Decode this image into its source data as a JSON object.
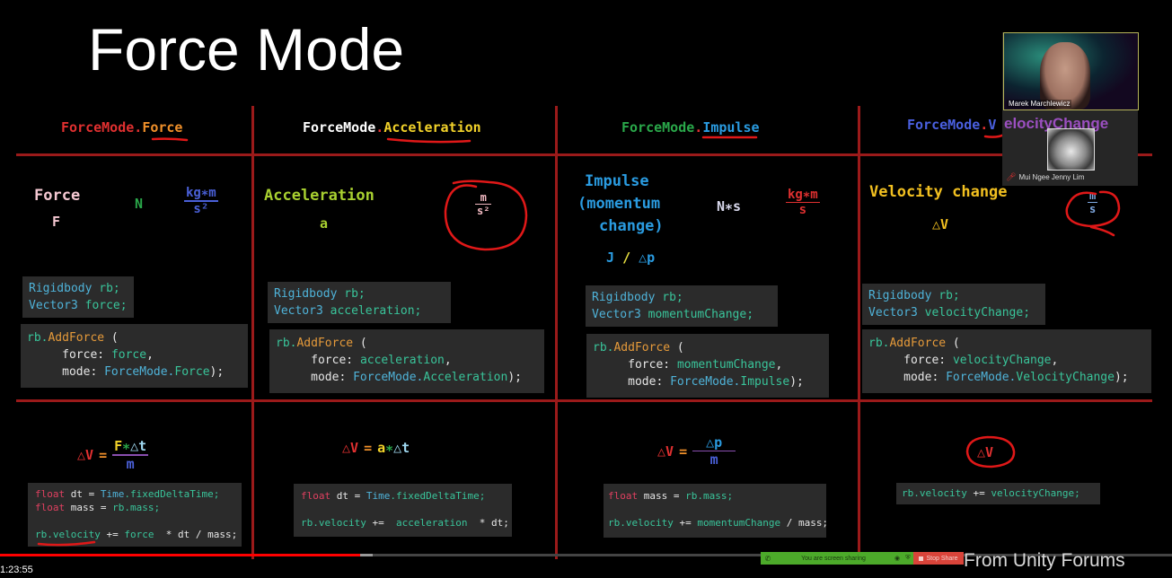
{
  "slide": {
    "title": "Force Mode",
    "columns": [
      {
        "header_prefix": "ForceMode",
        "header_dot": ".",
        "header_mode": "Force",
        "header_prefix_color": "#e03030",
        "header_mode_color": "#f0902a",
        "quantity_label": "Force",
        "quantity_symbol": "F",
        "unit_name": "N",
        "unit_num": "kg∗m",
        "unit_den": "s²",
        "declarations": [
          "Rigidbody",
          "rb;",
          "Vector3",
          "force;"
        ],
        "call": {
          "obj": "rb.",
          "fn": "AddForce",
          "paren": " (",
          "force_label": "force: ",
          "force_value": "force",
          "mode_label": "mode: ",
          "mode_class": "ForceMode.",
          "mode_value": "Force",
          "end": ");"
        },
        "formula": {
          "lhs": "△V",
          "eq": "=",
          "num_a": "F",
          "num_op": "∗",
          "num_b": "△t",
          "den": "m"
        },
        "snippet": [
          "float",
          "dt = ",
          "Time",
          ".fixedDeltaTime;",
          "float",
          "mass = ",
          "rb.mass;",
          "rb.velocity",
          " += ",
          "force",
          "  * dt / mass;"
        ]
      },
      {
        "header_prefix": "ForceMode",
        "header_dot": ".",
        "header_mode": "Acceleration",
        "header_prefix_color": "#ffffff",
        "header_mode_color": "#f2d22a",
        "quantity_label": "Acceleration",
        "quantity_symbol": "a",
        "unit_num": "m",
        "unit_den": "s²",
        "declarations": [
          "Rigidbody",
          "rb;",
          "Vector3",
          "acceleration;"
        ],
        "call": {
          "obj": "rb.",
          "fn": "AddForce",
          "paren": " (",
          "force_label": "force: ",
          "force_value": "acceleration",
          "mode_label": "mode: ",
          "mode_class": "ForceMode.",
          "mode_value": "Acceleration",
          "end": ");"
        },
        "formula": {
          "lhs": "△V",
          "eq": "=",
          "a": "a",
          "op": "∗",
          "b": "△t"
        },
        "snippet": [
          "float",
          "dt = ",
          "Time",
          ".fixedDeltaTime;",
          "rb.velocity",
          " +=  ",
          "acceleration",
          "  * dt;"
        ]
      },
      {
        "header_prefix": "ForceMode",
        "header_dot": ".",
        "header_mode": "Impulse",
        "header_prefix_color": "#2aa84a",
        "header_mode_color": "#2a9be0",
        "quantity_label_1": "Impulse",
        "quantity_label_2": "(momentum",
        "quantity_label_3": "change)",
        "quantity_symbol_a": "J",
        "quantity_symbol_sep": "/",
        "quantity_symbol_b": "△p",
        "unit_name": "N∗s",
        "unit_num": "kg∗m",
        "unit_den": "s",
        "declarations": [
          "Rigidbody",
          "rb;",
          "Vector3",
          "momentumChange;"
        ],
        "call": {
          "obj": "rb.",
          "fn": "AddForce",
          "paren": " (",
          "force_label": "force: ",
          "force_value": "momentumChange",
          "mode_label": "mode: ",
          "mode_class": "ForceMode.",
          "mode_value": "Impulse",
          "end": ");"
        },
        "formula": {
          "lhs": "△V",
          "eq": "=",
          "num": "△p",
          "den": "m"
        },
        "snippet": [
          "float",
          "mass = ",
          "rb.mass;",
          "rb.velocity",
          " += ",
          "momentumChange",
          " / mass;"
        ]
      },
      {
        "header_prefix": "ForceMode",
        "header_dot": ".",
        "header_mode_visible": "V",
        "header_mode_overlay": "elocityChange",
        "header_prefix_color": "#4a60e0",
        "header_mode_color": "#9b4fc0",
        "quantity_label": "Velocity change",
        "quantity_symbol": "△V",
        "unit_num": "m",
        "unit_den": "s",
        "declarations": [
          "Rigidbody",
          "rb;",
          "Vector3",
          "velocityChange;"
        ],
        "call": {
          "obj": "rb.",
          "fn": "AddForce",
          "paren": " (",
          "force_label": "force: ",
          "force_value": "velocityChange",
          "mode_label": "mode: ",
          "mode_class": "ForceMode.",
          "mode_value": "VelocityChange",
          "end": ");"
        },
        "formula": {
          "lhs": "△V"
        },
        "snippet": [
          "rb.velocity",
          " += ",
          "velocityChange;"
        ]
      }
    ]
  },
  "video_call": {
    "speaker_name": "Marek Marchlewicz",
    "participant_name": "Mui Ngee Jenny Lim",
    "participant_muted": true
  },
  "screen_share_bar": {
    "status_text": "You are screen sharing",
    "stop_label": "Stop Share"
  },
  "player": {
    "timestamp": "1:23:55",
    "progress_fraction": 0.307,
    "buffered_fraction": 0.318
  },
  "watermark": "From Unity Forums",
  "colors": {
    "grid_line": "#9b1a1a",
    "annotation_red": "#e01818",
    "code_bg": "#2b2b2b",
    "share_green": "#4caa2a",
    "share_red": "#d9443a"
  }
}
